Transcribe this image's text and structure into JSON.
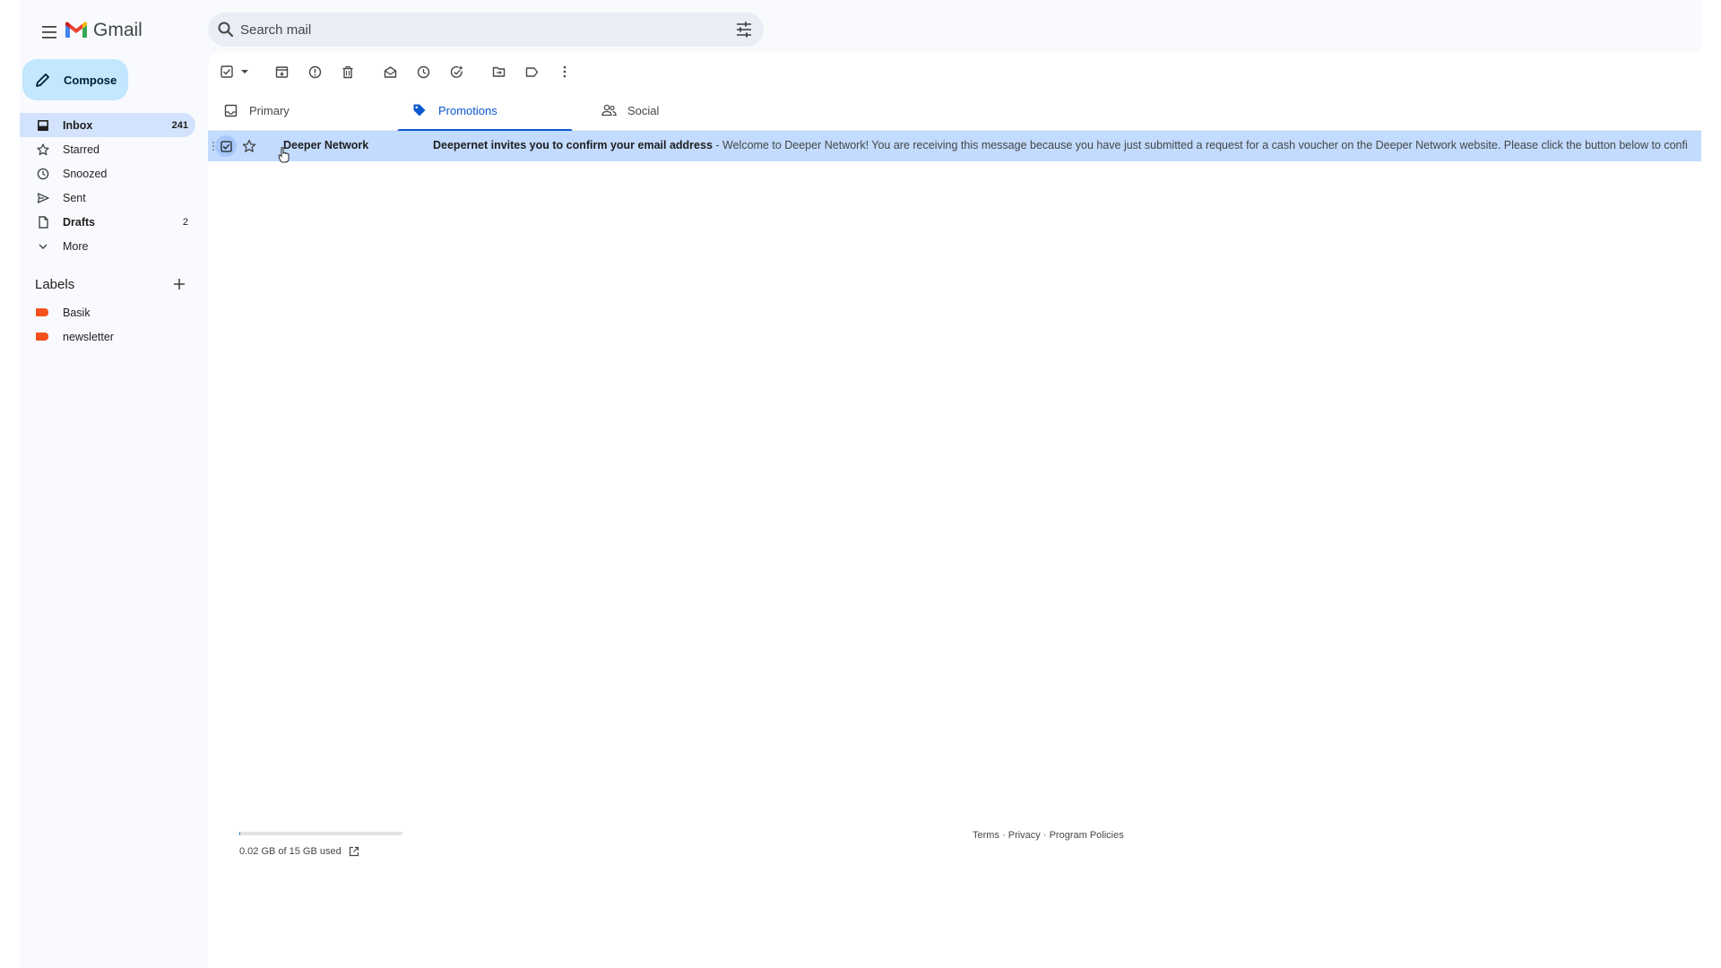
{
  "app": {
    "name": "Gmail"
  },
  "search": {
    "placeholder": "Search mail"
  },
  "sidebar": {
    "compose_label": "Compose",
    "items": [
      {
        "label": "Inbox",
        "count": "241"
      },
      {
        "label": "Starred",
        "count": ""
      },
      {
        "label": "Snoozed",
        "count": ""
      },
      {
        "label": "Sent",
        "count": ""
      },
      {
        "label": "Drafts",
        "count": "2"
      },
      {
        "label": "More",
        "count": ""
      }
    ],
    "labels_heading": "Labels",
    "labels": [
      {
        "label": "Basik",
        "color": "#f4511e"
      },
      {
        "label": "newsletter",
        "color": "#f4511e"
      }
    ]
  },
  "tabs": [
    {
      "label": "Primary",
      "icon": "inbox-icon"
    },
    {
      "label": "Promotions",
      "icon": "tag-icon"
    },
    {
      "label": "Social",
      "icon": "people-icon"
    }
  ],
  "emails": [
    {
      "sender": "Deeper Network",
      "subject": "Deepernet invites you to confirm your email address",
      "snippet": " - Welcome to Deeper Network! You are receiving this message because you have just submitted a request for a cash voucher on the Deeper Network website. Please click the button below to confirm your email"
    }
  ],
  "storage": {
    "text": "0.02 GB of 15 GB used",
    "used_fraction": 0.0013
  },
  "footer": {
    "terms": "Terms",
    "privacy": "Privacy",
    "policies": "Program Policies",
    "separator": " · "
  },
  "colors": {
    "accent": "#0b57d0",
    "compose_bg": "#c2e7ff",
    "selected_row": "#c2dbff",
    "label_tag": "#f4511e"
  }
}
